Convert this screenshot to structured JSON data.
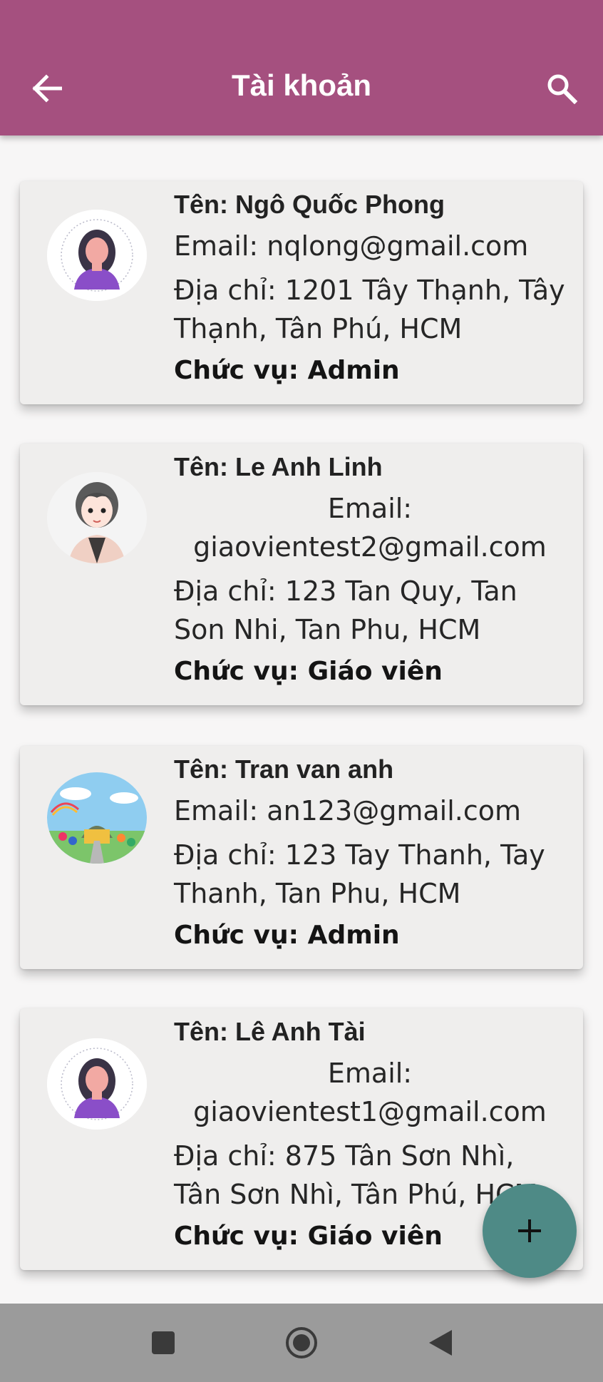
{
  "header": {
    "title": "Tài khoản",
    "back_icon": "arrow-left-icon",
    "search_icon": "search-icon",
    "background_color": "#a5507f"
  },
  "accounts": [
    {
      "name": "Tên: Ngô Quốc Phong",
      "email": "Email: nqlong@gmail.com",
      "address": "Địa chỉ: 1201 Tây Thạnh, Tây Thạnh, Tân Phú, HCM",
      "role": "Chức vụ: Admin",
      "avatar": "woman-avatar-icon"
    },
    {
      "name": "Tên: Le Anh Linh",
      "email": "Email: giaovientest2@gmail.com",
      "address": "Địa chỉ: 123 Tan Quy, Tan Son Nhi, Tan Phu, HCM",
      "role": "Chức vụ: Giáo viên",
      "avatar": "cartoon-teacher-avatar"
    },
    {
      "name": "Tên: Tran van anh",
      "email": "Email: an123@gmail.com",
      "address": "Địa chỉ: 123 Tay Thanh, Tay Thanh, Tan Phu, HCM",
      "role": "Chức vụ: Admin",
      "avatar": "school-illustration-avatar"
    },
    {
      "name": "Tên: Lê Anh Tài",
      "email": "Email: giaovientest1@gmail.com",
      "address": "Địa chỉ: 875 Tân Sơn Nhì, Tân Sơn Nhì, Tân Phú, HCM",
      "role": "Chức vụ: Giáo viên",
      "avatar": "woman-avatar-icon"
    }
  ],
  "fab": {
    "icon": "plus-icon",
    "color": "#4e8a86"
  },
  "system_nav": {
    "recents_icon": "square-icon",
    "home_icon": "circle-icon",
    "back_icon": "triangle-back-icon"
  }
}
